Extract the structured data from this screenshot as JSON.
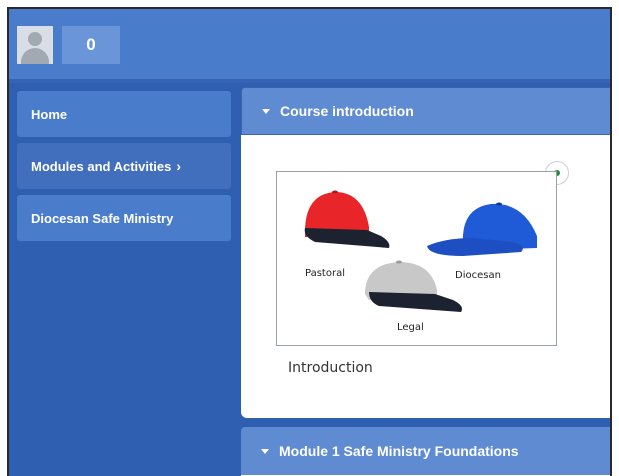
{
  "header": {
    "avatar_icon": "user-avatar-icon",
    "counter": "0",
    "colors": {
      "bar": "#4a7ccc",
      "background": "#2f5fb0"
    }
  },
  "sidebar": {
    "items": [
      {
        "label": "Home"
      },
      {
        "label": "Modules and Activities",
        "chevron": "›"
      },
      {
        "label": "Diocesan Safe Ministry"
      }
    ]
  },
  "sections": [
    {
      "title": "Course introduction",
      "activity": {
        "name": "Introduction",
        "image_labels": [
          "Pastoral",
          "Diocesan",
          "Legal"
        ],
        "completion": "complete"
      }
    },
    {
      "title": "Module 1 Safe Ministry Foundations"
    }
  ]
}
